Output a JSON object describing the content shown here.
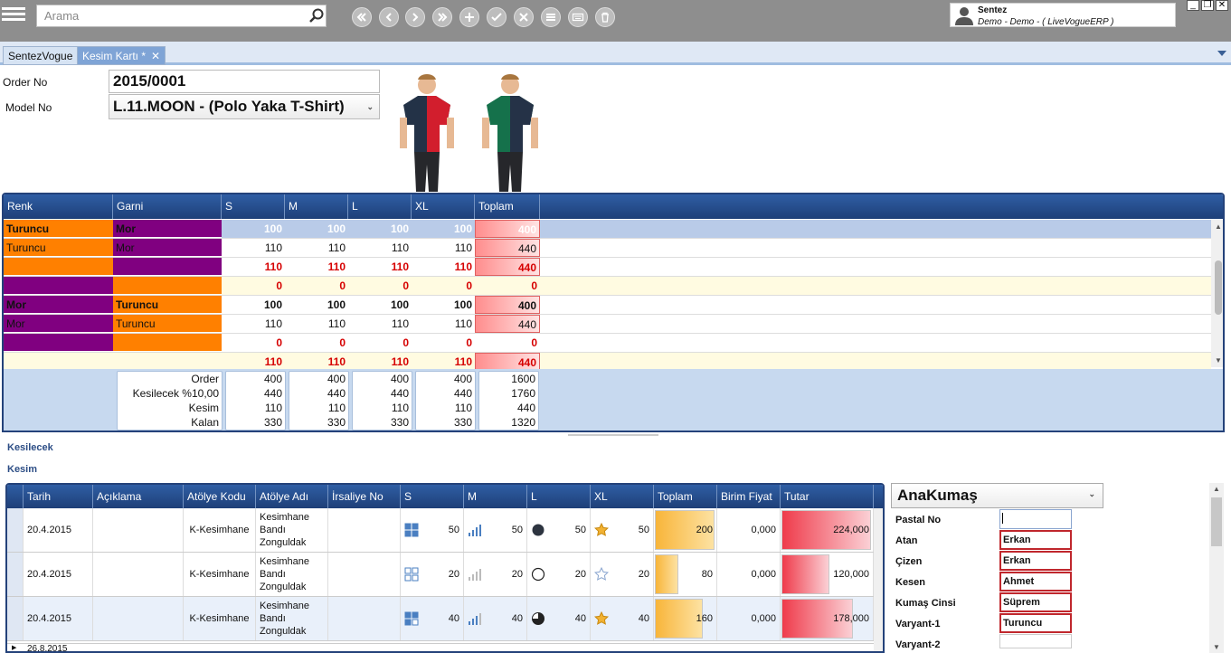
{
  "search": {
    "placeholder": "Arama"
  },
  "toolbar": {
    "icons": [
      "first-icon",
      "prev-icon",
      "next-icon",
      "last-icon",
      "add-icon",
      "check-icon",
      "cancel-icon",
      "list-icon",
      "keyboard-icon",
      "trash-icon"
    ]
  },
  "user": {
    "name": "Sentez",
    "info": "Demo - Demo - ( LiveVogueERP )"
  },
  "tabs": [
    {
      "label": "SentezVogue"
    },
    {
      "label": "Kesim Kartı *",
      "close": "✕"
    }
  ],
  "form": {
    "order_label": "Order No",
    "order_value": "2015/0001",
    "model_label": "Model No",
    "model_value": "L.11.MOON - (Polo Yaka T-Shirt)"
  },
  "colors": {
    "orange": "#ff8000",
    "purple": "#800080",
    "yellow_row": "#fffbe1",
    "red": "#d60000",
    "header": "#1e3f78"
  },
  "grid1": {
    "headers": [
      "Renk",
      "Garni",
      "S",
      "M",
      "L",
      "XL",
      "Toplam"
    ],
    "rows": [
      {
        "renk": "Turuncu",
        "garni": "Mor",
        "s": "100",
        "m": "100",
        "l": "100",
        "xl": "100",
        "toplam": "400",
        "style": "selected"
      },
      {
        "renk": "Turuncu",
        "garni": "Mor",
        "s": "110",
        "m": "110",
        "l": "110",
        "xl": "110",
        "toplam": "440",
        "style": "normal"
      },
      {
        "renk": "",
        "garni": "",
        "s": "110",
        "m": "110",
        "l": "110",
        "xl": "110",
        "toplam": "440",
        "style": "red"
      },
      {
        "renk": "",
        "garni": "",
        "s": "0",
        "m": "0",
        "l": "0",
        "xl": "0",
        "toplam": "0",
        "style": "yellow"
      },
      {
        "renk": "Mor",
        "garni": "Turuncu",
        "s": "100",
        "m": "100",
        "l": "100",
        "xl": "100",
        "toplam": "400",
        "style": "bold"
      },
      {
        "renk": "Mor",
        "garni": "Turuncu",
        "s": "110",
        "m": "110",
        "l": "110",
        "xl": "110",
        "toplam": "440",
        "style": "normal"
      },
      {
        "renk": "",
        "garni": "",
        "s": "0",
        "m": "0",
        "l": "0",
        "xl": "0",
        "toplam": "0",
        "style": "red"
      },
      {
        "renk": "",
        "garni": "",
        "s": "110",
        "m": "110",
        "l": "110",
        "xl": "110",
        "toplam": "440",
        "style": "yellow"
      }
    ],
    "summary": {
      "labels": [
        "Order",
        "Kesilecek %10,00",
        "Kesim",
        "Kalan"
      ],
      "s": [
        "400",
        "440",
        "110",
        "330"
      ],
      "m": [
        "400",
        "440",
        "110",
        "330"
      ],
      "l": [
        "400",
        "440",
        "110",
        "330"
      ],
      "xl": [
        "400",
        "440",
        "110",
        "330"
      ],
      "toplam": [
        "1600",
        "1760",
        "440",
        "1320"
      ]
    }
  },
  "sections": {
    "kesilecek": "Kesilecek",
    "kesim": "Kesim"
  },
  "grid2": {
    "headers": [
      "Tarih",
      "Açıklama",
      "Atölye Kodu",
      "Atölye Adı",
      "İrsaliye No",
      "S",
      "M",
      "L",
      "XL",
      "Toplam",
      "Birim Fiyat",
      "Tutar"
    ],
    "rows": [
      {
        "tarih": "20.4.2015",
        "aciklama": "",
        "kod": "K-Kesimhane",
        "ad": "Kesimhane Bandı Zonguldak",
        "irsaliye": "",
        "s": "50",
        "m": "50",
        "l": "50",
        "xl": "50",
        "toplam": "200",
        "toplam_fill": 1.0,
        "fiyat": "0,000",
        "tutar": "224,000",
        "tutar_fill": 1.0
      },
      {
        "tarih": "20.4.2015",
        "aciklama": "",
        "kod": "K-Kesimhane",
        "ad": "Kesimhane Bandı Zonguldak",
        "irsaliye": "",
        "s": "20",
        "m": "20",
        "l": "20",
        "xl": "20",
        "toplam": "80",
        "toplam_fill": 0.4,
        "fiyat": "0,000",
        "tutar": "120,000",
        "tutar_fill": 0.54
      },
      {
        "tarih": "20.4.2015",
        "aciklama": "",
        "kod": "K-Kesimhane",
        "ad": "Kesimhane Bandı Zonguldak",
        "irsaliye": "",
        "s": "40",
        "m": "40",
        "l": "40",
        "xl": "40",
        "toplam": "160",
        "toplam_fill": 0.8,
        "fiyat": "0,000",
        "tutar": "178,000",
        "tutar_fill": 0.8
      }
    ],
    "partial_row": "26.8.2015"
  },
  "panel": {
    "combo": "AnaKumaş",
    "fields": [
      {
        "label": "Pastal No",
        "value": ""
      },
      {
        "label": "Atan",
        "value": "Erkan"
      },
      {
        "label": "Çizen",
        "value": "Erkan"
      },
      {
        "label": "Kesen",
        "value": "Ahmet"
      },
      {
        "label": "Kumaş Cinsi",
        "value": "Süprem"
      },
      {
        "label": "Varyant-1",
        "value": "Turuncu"
      },
      {
        "label": "Varyant-2",
        "value": ""
      }
    ]
  }
}
